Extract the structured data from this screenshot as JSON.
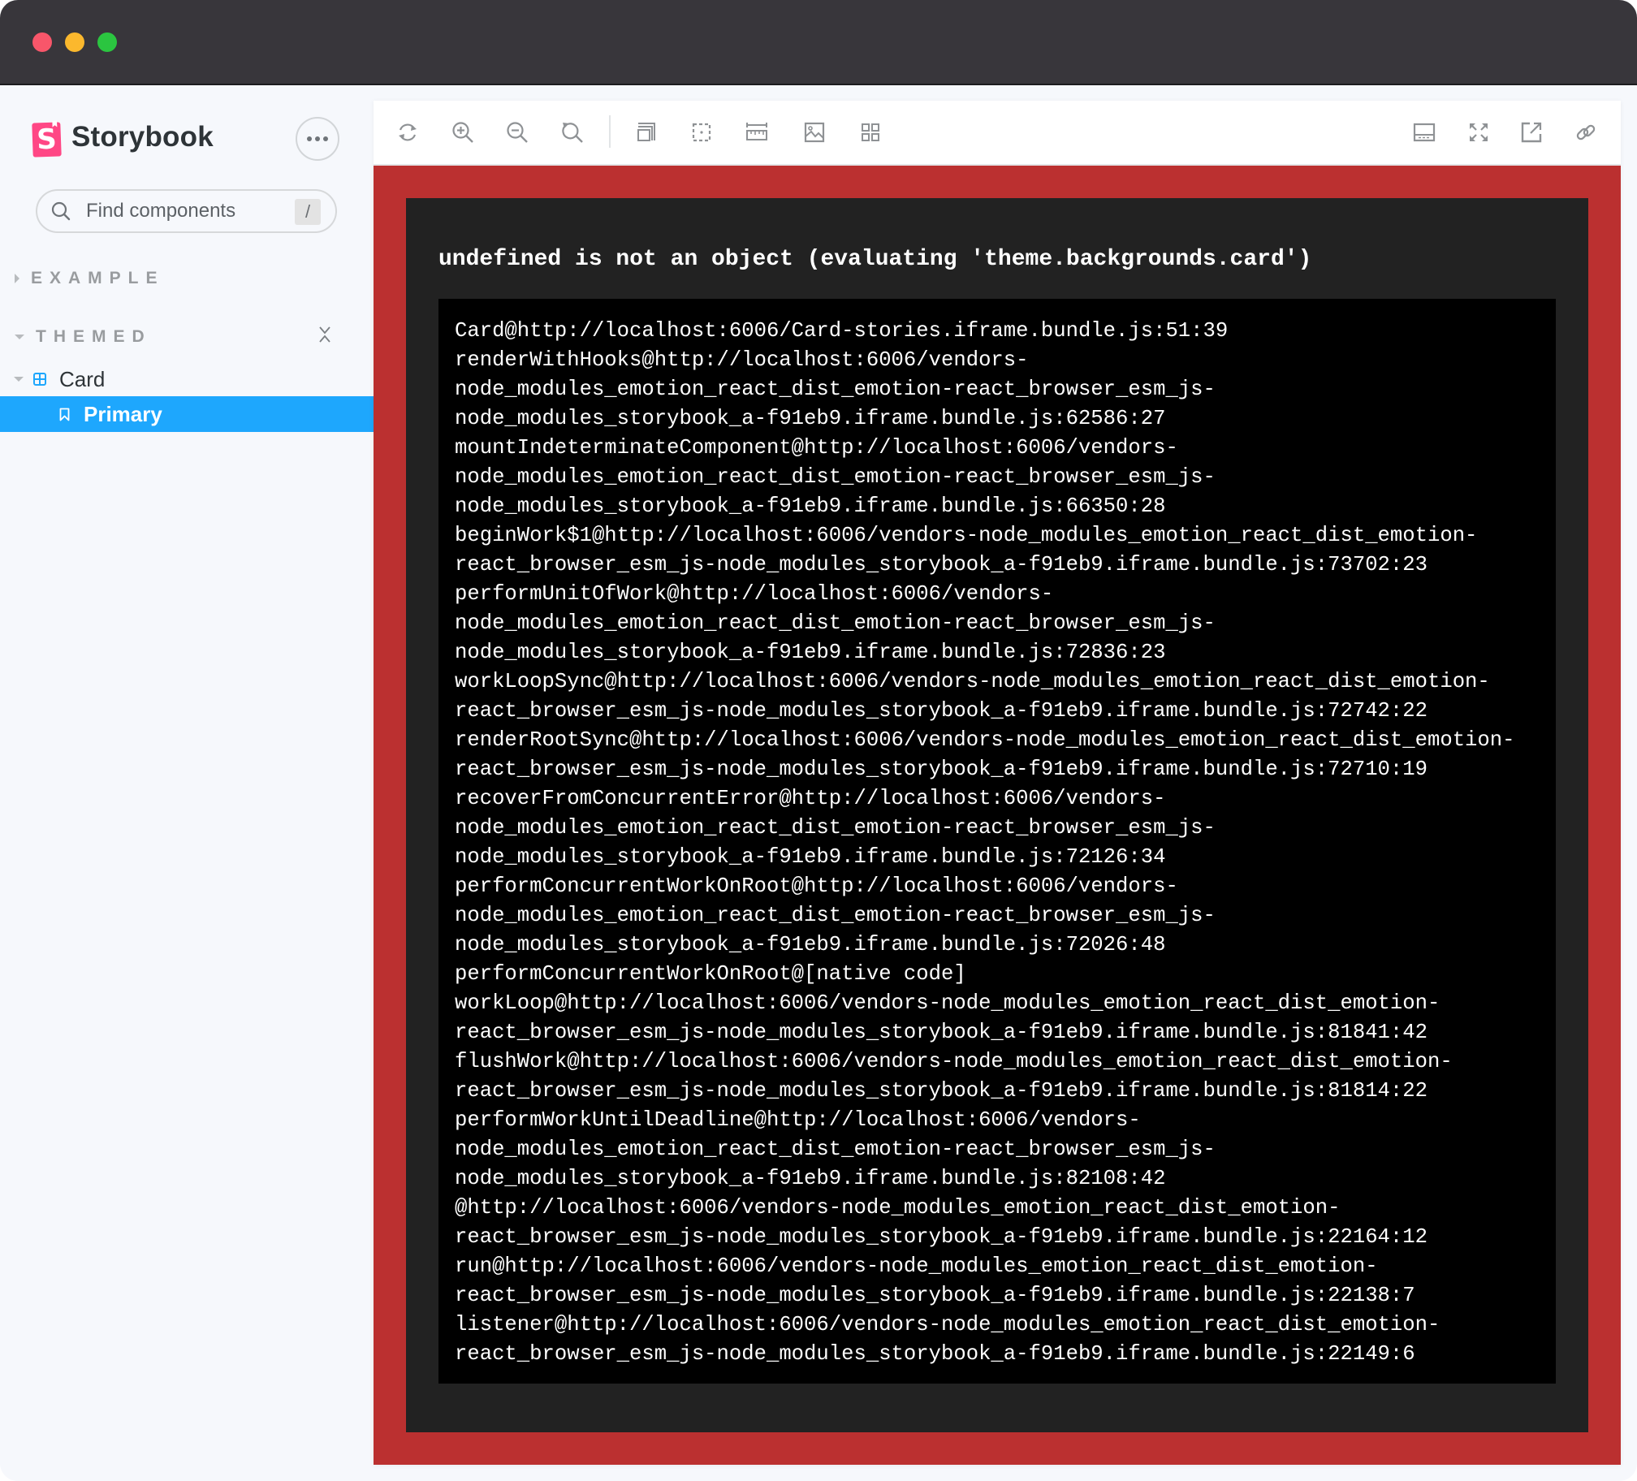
{
  "window": {
    "traffic_lights": [
      "close",
      "minimize",
      "zoom"
    ]
  },
  "sidebar": {
    "brand": "Storybook",
    "logo_letter": "S",
    "more_button_icon": "ellipsis-icon",
    "search": {
      "placeholder": "Find components",
      "value": "",
      "shortcut": "/"
    },
    "groups": [
      {
        "label": "EXAMPLE",
        "expanded": false
      },
      {
        "label": "THEMED",
        "expanded": true
      }
    ],
    "tree": {
      "component": "Card",
      "story": "Primary",
      "selected": "Primary"
    }
  },
  "toolbar": {
    "left_buttons": [
      {
        "name": "remount",
        "icon": "sync-icon"
      },
      {
        "name": "zoom-in",
        "icon": "zoom-in-icon"
      },
      {
        "name": "zoom-out",
        "icon": "zoom-out-icon"
      },
      {
        "name": "zoom-reset",
        "icon": "zoom-reset-icon"
      },
      {
        "name": "background",
        "icon": "backgrounds-icon"
      },
      {
        "name": "outline",
        "icon": "outline-icon"
      },
      {
        "name": "measure",
        "icon": "ruler-icon"
      },
      {
        "name": "image",
        "icon": "image-icon"
      },
      {
        "name": "grid",
        "icon": "grid-icon"
      }
    ],
    "right_buttons": [
      {
        "name": "toggle-addons",
        "icon": "bottom-bar-icon"
      },
      {
        "name": "fullscreen",
        "icon": "expand-icon"
      },
      {
        "name": "open-new-tab",
        "icon": "share-alt-icon"
      },
      {
        "name": "copy-link",
        "icon": "link-icon"
      }
    ]
  },
  "error": {
    "colors": {
      "frame": "#BB3030",
      "box": "#222222",
      "stack_bg": "#000000",
      "text": "#FFFFFF"
    },
    "message": "undefined is not an object (evaluating 'theme.backgrounds.card')",
    "stack": [
      "Card@http://localhost:6006/Card-stories.iframe.bundle.js:51:39",
      "renderWithHooks@http://localhost:6006/vendors-",
      "node_modules_emotion_react_dist_emotion-react_browser_esm_js-",
      "node_modules_storybook_a-f91eb9.iframe.bundle.js:62586:27",
      "mountIndeterminateComponent@http://localhost:6006/vendors-",
      "node_modules_emotion_react_dist_emotion-react_browser_esm_js-",
      "node_modules_storybook_a-f91eb9.iframe.bundle.js:66350:28",
      "beginWork$1@http://localhost:6006/vendors-node_modules_emotion_react_dist_emotion-",
      "react_browser_esm_js-node_modules_storybook_a-f91eb9.iframe.bundle.js:73702:23",
      "performUnitOfWork@http://localhost:6006/vendors-",
      "node_modules_emotion_react_dist_emotion-react_browser_esm_js-",
      "node_modules_storybook_a-f91eb9.iframe.bundle.js:72836:23",
      "workLoopSync@http://localhost:6006/vendors-node_modules_emotion_react_dist_emotion-",
      "react_browser_esm_js-node_modules_storybook_a-f91eb9.iframe.bundle.js:72742:22",
      "renderRootSync@http://localhost:6006/vendors-node_modules_emotion_react_dist_emotion-",
      "react_browser_esm_js-node_modules_storybook_a-f91eb9.iframe.bundle.js:72710:19",
      "recoverFromConcurrentError@http://localhost:6006/vendors-",
      "node_modules_emotion_react_dist_emotion-react_browser_esm_js-",
      "node_modules_storybook_a-f91eb9.iframe.bundle.js:72126:34",
      "performConcurrentWorkOnRoot@http://localhost:6006/vendors-",
      "node_modules_emotion_react_dist_emotion-react_browser_esm_js-",
      "node_modules_storybook_a-f91eb9.iframe.bundle.js:72026:48",
      "performConcurrentWorkOnRoot@[native code]",
      "workLoop@http://localhost:6006/vendors-node_modules_emotion_react_dist_emotion-",
      "react_browser_esm_js-node_modules_storybook_a-f91eb9.iframe.bundle.js:81841:42",
      "flushWork@http://localhost:6006/vendors-node_modules_emotion_react_dist_emotion-",
      "react_browser_esm_js-node_modules_storybook_a-f91eb9.iframe.bundle.js:81814:22",
      "performWorkUntilDeadline@http://localhost:6006/vendors-",
      "node_modules_emotion_react_dist_emotion-react_browser_esm_js-",
      "node_modules_storybook_a-f91eb9.iframe.bundle.js:82108:42",
      "@http://localhost:6006/vendors-node_modules_emotion_react_dist_emotion-",
      "react_browser_esm_js-node_modules_storybook_a-f91eb9.iframe.bundle.js:22164:12",
      "run@http://localhost:6006/vendors-node_modules_emotion_react_dist_emotion-",
      "react_browser_esm_js-node_modules_storybook_a-f91eb9.iframe.bundle.js:22138:7",
      "listener@http://localhost:6006/vendors-node_modules_emotion_react_dist_emotion-",
      "react_browser_esm_js-node_modules_storybook_a-f91eb9.iframe.bundle.js:22149:6"
    ]
  }
}
